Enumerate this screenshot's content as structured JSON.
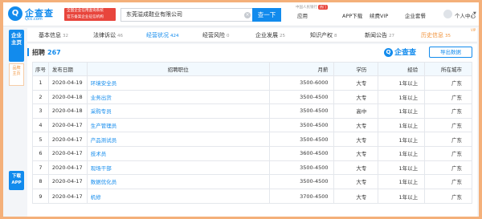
{
  "header": {
    "logo_text": "企查查",
    "logo_sub": "Qcc.com",
    "gov_badge_line1": "全国企业信用查询系统",
    "gov_badge_line2": "官方备案企业征信机构",
    "search_value": "东莞溢成鞋业有限公司",
    "search_button": "查一下",
    "hot_label": "热门",
    "small_note": "中国人民银行",
    "links": [
      "应用",
      "APP下载",
      "续费VIP",
      "企业套餐"
    ],
    "user_label": "个人中心"
  },
  "rail": {
    "main_line1": "企业",
    "main_line2": "主页",
    "brand_line1": "品牌",
    "brand_line2": "主页",
    "app_line1": "下载",
    "app_line2": "APP"
  },
  "tabs": [
    {
      "label": "基本信息",
      "count": "32"
    },
    {
      "label": "法律诉讼",
      "count": "46"
    },
    {
      "label": "经营状况",
      "count": "424"
    },
    {
      "label": "经营风险",
      "count": "0"
    },
    {
      "label": "企业发展",
      "count": "25"
    },
    {
      "label": "知识产权",
      "count": "8"
    },
    {
      "label": "新闻公告",
      "count": "27"
    },
    {
      "label": "历史信息",
      "count": "35"
    }
  ],
  "vip_tag": "VIP",
  "section": {
    "title": "招聘",
    "count": "267",
    "watermark": "企查查",
    "export_label": "导出数据"
  },
  "table": {
    "headers": [
      "序号",
      "发布日期",
      "招聘职位",
      "月薪",
      "学历",
      "经验",
      "所在城市"
    ],
    "rows": [
      {
        "no": "1",
        "date": "2020-04-19",
        "position": "环境安全员",
        "salary": "3500-6000",
        "education": "大专",
        "experience": "1年以上",
        "city": "广东"
      },
      {
        "no": "2",
        "date": "2020-04-18",
        "position": "业务出货",
        "salary": "3500-4500",
        "education": "大专",
        "experience": "1年以上",
        "city": "广东"
      },
      {
        "no": "3",
        "date": "2020-04-18",
        "position": "采购专员",
        "salary": "3500-4500",
        "education": "高中",
        "experience": "1年以上",
        "city": "广东"
      },
      {
        "no": "4",
        "date": "2020-04-17",
        "position": "生产管理员",
        "salary": "3500-4500",
        "education": "大专",
        "experience": "1年以上",
        "city": "广东"
      },
      {
        "no": "5",
        "date": "2020-04-17",
        "position": "产品测试员",
        "salary": "3500-4500",
        "education": "大专",
        "experience": "1年以上",
        "city": "广东"
      },
      {
        "no": "6",
        "date": "2020-04-17",
        "position": "技术员",
        "salary": "3600-4500",
        "education": "大专",
        "experience": "1年以上",
        "city": "广东"
      },
      {
        "no": "7",
        "date": "2020-04-17",
        "position": "现场干部",
        "salary": "3500-4500",
        "education": "大专",
        "experience": "1年以上",
        "city": "广东"
      },
      {
        "no": "8",
        "date": "2020-04-17",
        "position": "数据优化员",
        "salary": "3500-4500",
        "education": "大专",
        "experience": "1年以上",
        "city": "广东"
      },
      {
        "no": "9",
        "date": "2020-04-17",
        "position": "机修",
        "salary": "3700-4500",
        "education": "大专",
        "experience": "1年以上",
        "city": "广东"
      }
    ]
  },
  "colors": {
    "accent": "#128bed",
    "history": "#f0923a",
    "badge": "#e8453c",
    "frame": "#f4b07a"
  }
}
